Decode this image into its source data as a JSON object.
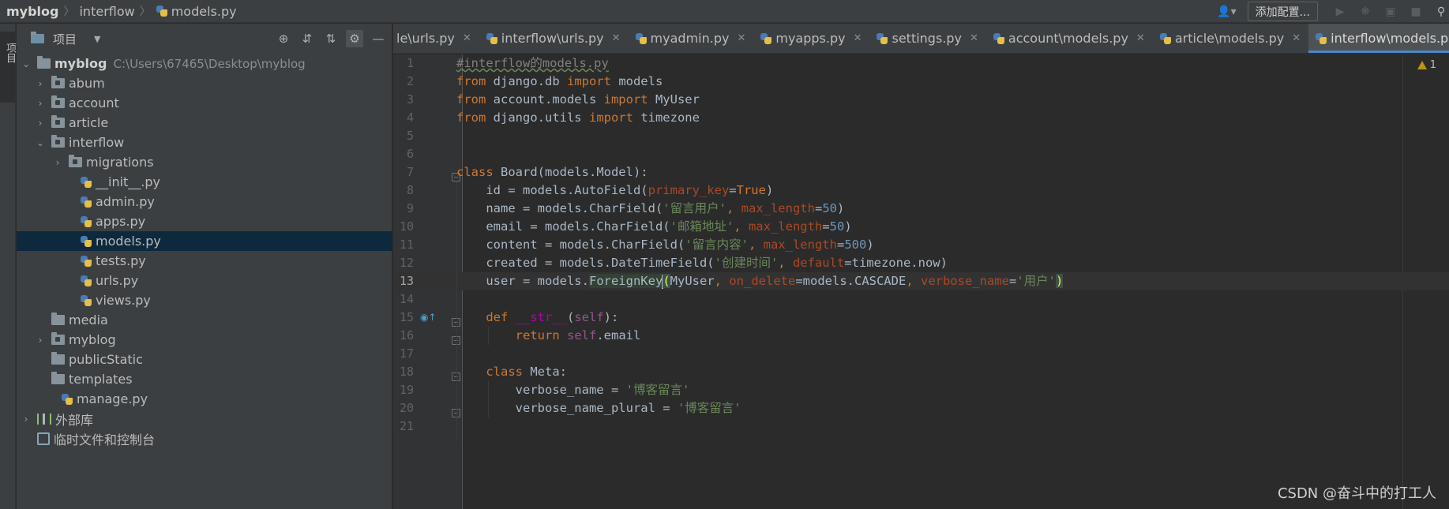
{
  "navbar": {
    "crumbs": [
      "myblog",
      "interflow",
      "models.py"
    ],
    "add_config_label": "添加配置...",
    "user_icon": "user-icon"
  },
  "toolstrip": {
    "project_label": "项目"
  },
  "project_panel": {
    "title": "项目",
    "root": {
      "name": "myblog",
      "path": "C:\\Users\\67465\\Desktop\\myblog"
    },
    "items": [
      {
        "label": "abum",
        "type": "folder"
      },
      {
        "label": "account",
        "type": "folder"
      },
      {
        "label": "article",
        "type": "folder"
      },
      {
        "label": "interflow",
        "type": "folder"
      },
      {
        "label": "migrations",
        "type": "folder"
      },
      {
        "label": "__init__.py",
        "type": "file"
      },
      {
        "label": "admin.py",
        "type": "file"
      },
      {
        "label": "apps.py",
        "type": "file"
      },
      {
        "label": "models.py",
        "type": "file"
      },
      {
        "label": "tests.py",
        "type": "file"
      },
      {
        "label": "urls.py",
        "type": "file"
      },
      {
        "label": "views.py",
        "type": "file"
      },
      {
        "label": "media",
        "type": "folder"
      },
      {
        "label": "myblog",
        "type": "folder"
      },
      {
        "label": "publicStatic",
        "type": "folder"
      },
      {
        "label": "templates",
        "type": "folder"
      },
      {
        "label": "manage.py",
        "type": "file"
      },
      {
        "label": "外部库",
        "type": "library"
      },
      {
        "label": "临时文件和控制台",
        "type": "scratch"
      }
    ]
  },
  "tabs": [
    {
      "label": "le\\urls.py"
    },
    {
      "label": "interflow\\urls.py"
    },
    {
      "label": "myadmin.py"
    },
    {
      "label": "myapps.py"
    },
    {
      "label": "settings.py"
    },
    {
      "label": "account\\models.py"
    },
    {
      "label": "article\\models.py"
    },
    {
      "label": "interflow\\models.py"
    }
  ],
  "editor": {
    "line_numbers": [
      "1",
      "2",
      "3",
      "4",
      "5",
      "6",
      "7",
      "8",
      "9",
      "10",
      "11",
      "12",
      "13",
      "14",
      "15",
      "16",
      "17",
      "18",
      "19",
      "20",
      "21"
    ],
    "current_line": "13",
    "warnings_count": "1",
    "code": {
      "l1": "#interflow的models.py",
      "l2_from": "from",
      "l2_mod": " django.db ",
      "l2_imp": "import",
      "l2_name": " models",
      "l3_from": "from",
      "l3_mod": " account.models ",
      "l3_imp": "import",
      "l3_name": " MyUser",
      "l4_from": "from",
      "l4_mod": " django.utils ",
      "l4_imp": "import",
      "l4_name": " timezone",
      "l7_kw": "class",
      "l7_rest": " Board(models.Model):",
      "l8_a": "id = models.AutoField(",
      "l8_p": "primary_key",
      "l8_b": "=",
      "l8_v": "True",
      "l8_c": ")",
      "l9_a": "name = models.CharField(",
      "l9_s": "'留言用户'",
      "l9_b": ", ",
      "l9_p": "max_length",
      "l9_e": "=",
      "l9_n": "50",
      "l9_c": ")",
      "l10_a": "email = models.CharField(",
      "l10_s": "'邮箱地址'",
      "l10_b": ", ",
      "l10_p": "max_length",
      "l10_e": "=",
      "l10_n": "50",
      "l10_c": ")",
      "l11_a": "content = models.CharField(",
      "l11_s": "'留言内容'",
      "l11_b": ", ",
      "l11_p": "max_length",
      "l11_e": "=",
      "l11_n": "500",
      "l11_c": ")",
      "l12_a": "created = models.DateTimeField(",
      "l12_s": "'创建时间'",
      "l12_b": ", ",
      "l12_p": "default",
      "l12_c": "=timezone.now)",
      "l13_a": "user = models.",
      "l13_fk": "ForeignKey",
      "l13_op": "(",
      "l13_b": "MyUser",
      "l13_c": ", ",
      "l13_p1": "on_delete",
      "l13_d": "=models.CASCADE",
      "l13_e": ", ",
      "l13_p2": "verbose_name",
      "l13_f": "=",
      "l13_s": "'用户'",
      "l13_cp": ")",
      "l15_kw": "def",
      "l15_sp": " ",
      "l15_dn": "__str__",
      "l15_op": "(",
      "l15_self": "self",
      "l15_cl": "):",
      "l16_kw": "return",
      "l16_sp": " ",
      "l16_self": "self",
      "l16_rest": ".email",
      "l18_kw": "class",
      "l18_rest": " Meta:",
      "l19_a": "verbose_name = ",
      "l19_s": "'博客留言'",
      "l20_a": "verbose_name_plural = ",
      "l20_s": "'博客留言'"
    }
  },
  "watermark": "CSDN @奋斗中的打工人"
}
